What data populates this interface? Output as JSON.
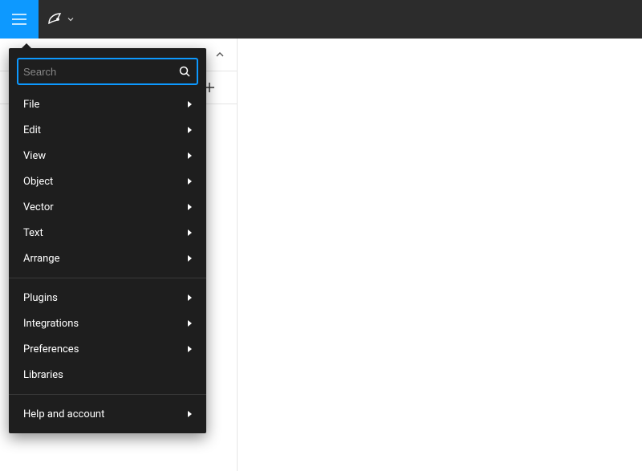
{
  "toolbar": {
    "tools": [
      {
        "name": "move-tool",
        "icon": "cursor",
        "hasChevron": true
      },
      {
        "name": "frame-tool",
        "icon": "frame",
        "hasChevron": true
      },
      {
        "name": "shape-tool",
        "icon": "rect",
        "hasChevron": true
      },
      {
        "name": "pen-tool",
        "icon": "pen",
        "hasChevron": true
      },
      {
        "name": "text-tool",
        "icon": "text",
        "hasChevron": false
      },
      {
        "name": "hand-tool",
        "icon": "hand",
        "hasChevron": false
      },
      {
        "name": "comment-tool",
        "icon": "comment",
        "hasChevron": false
      }
    ]
  },
  "sidebar": {
    "row1_caret_name": "panel-collapse-caret"
  },
  "menu": {
    "search_placeholder": "Search",
    "groups": [
      [
        {
          "label": "File",
          "submenu": true
        },
        {
          "label": "Edit",
          "submenu": true
        },
        {
          "label": "View",
          "submenu": true
        },
        {
          "label": "Object",
          "submenu": true
        },
        {
          "label": "Vector",
          "submenu": true
        },
        {
          "label": "Text",
          "submenu": true
        },
        {
          "label": "Arrange",
          "submenu": true
        }
      ],
      [
        {
          "label": "Plugins",
          "submenu": true
        },
        {
          "label": "Integrations",
          "submenu": true
        },
        {
          "label": "Preferences",
          "submenu": true
        },
        {
          "label": "Libraries",
          "submenu": false
        }
      ],
      [
        {
          "label": "Help and account",
          "submenu": true
        }
      ]
    ]
  }
}
